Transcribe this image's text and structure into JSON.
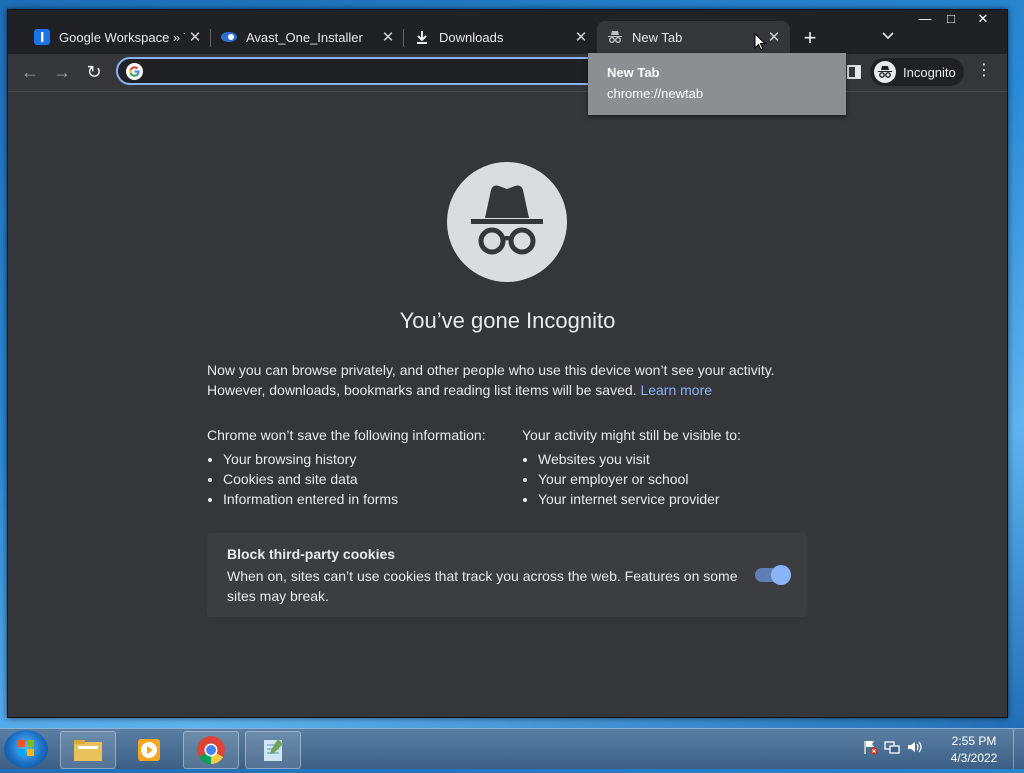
{
  "browser": {
    "tabs": [
      {
        "title": "Google Workspace » Th",
        "favicon": "workspace-i-icon"
      },
      {
        "title": "Avast_One_Installer",
        "favicon": "avast-icon"
      },
      {
        "title": "Downloads",
        "favicon": "download-icon"
      },
      {
        "title": "New Tab",
        "favicon": "incognito-icon",
        "active": true
      }
    ],
    "close_glyph": "✕",
    "new_tab_glyph": "+",
    "tab_search_glyph": "⌄",
    "window_controls": {
      "minimize": "—",
      "maximize": "□",
      "close": "✕"
    },
    "toolbar": {
      "back_glyph": "←",
      "forward_glyph": "→",
      "reload_glyph": "↻",
      "omnibox_value": "",
      "profile_label": "Incognito",
      "menu_glyph": "⋮"
    },
    "tooltip": {
      "title": "New Tab",
      "url": "chrome://newtab"
    }
  },
  "page": {
    "heading": "You’ve gone Incognito",
    "intro": "Now you can browse privately, and other people who use this device won’t see your activity. However, downloads, bookmarks and reading list items will be saved.",
    "learn_more": "Learn more",
    "not_saved": {
      "title": "Chrome won’t save the following information:",
      "items": [
        "Your browsing history",
        "Cookies and site data",
        "Information entered in forms"
      ]
    },
    "visible": {
      "title": "Your activity might still be visible to:",
      "items": [
        "Websites you visit",
        "Your employer or school",
        "Your internet service provider"
      ]
    },
    "cookies": {
      "title": "Block third-party cookies",
      "description": "When on, sites can’t use cookies that track you across the web. Features on some sites may break.",
      "enabled": true
    }
  },
  "taskbar": {
    "apps": [
      "explorer",
      "media-player",
      "chrome",
      "notepad"
    ],
    "time": "2:55 PM",
    "date": "4/3/2022"
  },
  "colors": {
    "accent": "#8ab4f8",
    "background": "#35363a",
    "titlebar": "#202124"
  }
}
